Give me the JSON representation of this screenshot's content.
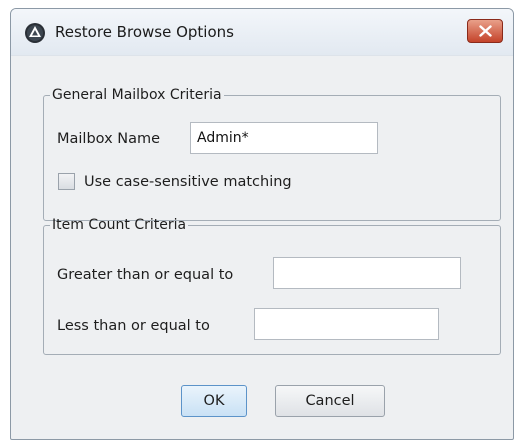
{
  "window": {
    "title": "Restore Browse Options",
    "icon": "app-logo-icon",
    "close_icon": "close-icon"
  },
  "general_criteria": {
    "legend": "General Mailbox Criteria",
    "mailbox_name_label": "Mailbox Name",
    "mailbox_name_value": "Admin*",
    "case_sensitive_label": "Use case-sensitive matching",
    "case_sensitive_checked": false
  },
  "item_count_criteria": {
    "legend": "Item Count Criteria",
    "greater_than_label": "Greater than or equal to",
    "greater_than_value": "",
    "less_than_label": "Less than or equal to",
    "less_than_value": ""
  },
  "buttons": {
    "ok_label": "OK",
    "cancel_label": "Cancel"
  },
  "colors": {
    "close_button": "#c4432a",
    "ok_button_border": "#5c93c9"
  }
}
